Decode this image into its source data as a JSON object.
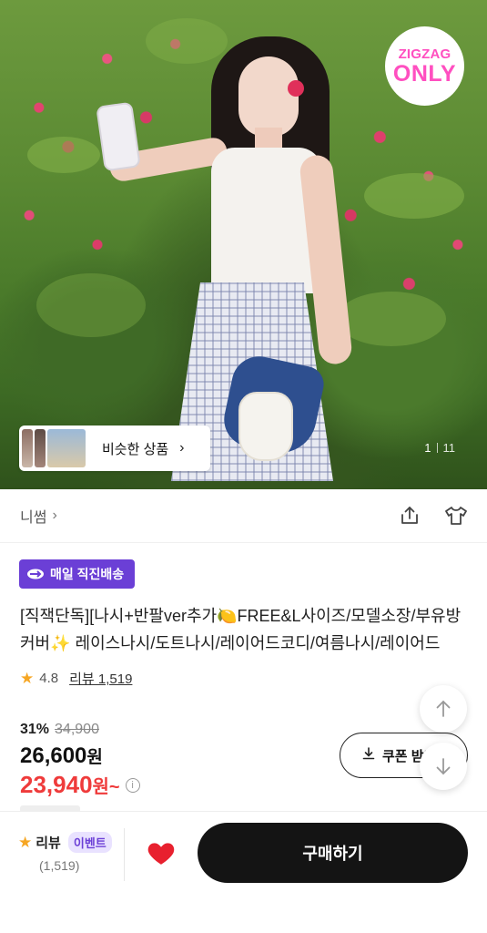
{
  "hero": {
    "badge_line1": "ZIGZAG",
    "badge_line2": "ONLY",
    "similar_label": "비슷한 상품",
    "pager_current": "1",
    "pager_total": "11"
  },
  "store": {
    "name": "니썸",
    "icons": [
      "share-icon",
      "outfit-icon"
    ]
  },
  "product": {
    "delivery_badge": "매일 직진배송",
    "title": "[직잭단독][나시+반팔ver추가🍋FREE&L사이즈/모델소장/부유방커버✨ 레이스나시/도트나시/레이어드코디/여름나시/레이어드",
    "rating": "4.8",
    "review_label": "리뷰 1,519",
    "discount_rate": "31%",
    "original_price": "34,900",
    "price": "26,600",
    "price_unit": "원",
    "coupon_price": "23,940",
    "coupon_unit": "원~",
    "coupon_button": "쿠폰 받기"
  },
  "bottom": {
    "review_label": "리뷰",
    "event_badge": "이벤트",
    "review_count": "(1,519)",
    "buy_button": "구매하기"
  },
  "colors": {
    "accent_purple": "#6b3fd6",
    "price_red": "#ef3b3b",
    "badge_pink": "#ff4fc0",
    "buy_button_bg": "#141414",
    "heart_red": "#e8202e",
    "star": "#f6a623"
  }
}
